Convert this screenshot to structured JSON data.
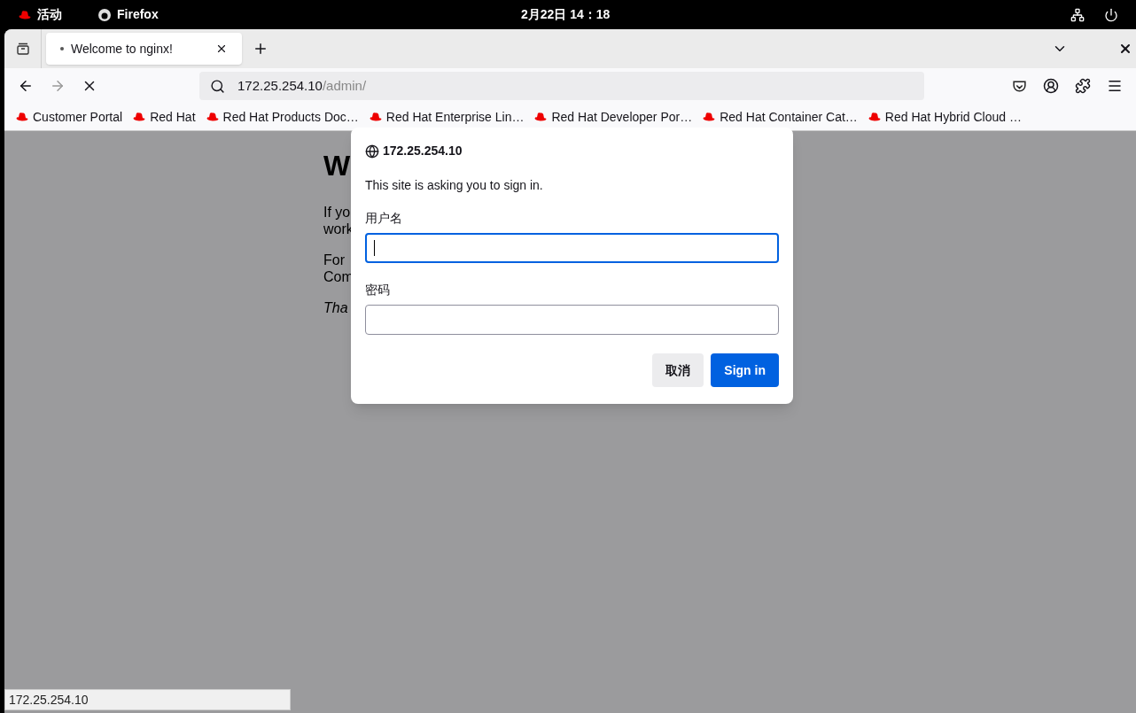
{
  "topbar": {
    "activities": "活动",
    "app": "Firefox",
    "clock": "2月22日 14：18"
  },
  "tabs": [
    {
      "title": "Welcome to nginx!",
      "selected": true,
      "loading": true
    }
  ],
  "urlbar": {
    "host": "172.25.254.10",
    "path": "/admin/"
  },
  "bookmarks": [
    "Customer Portal",
    "Red Hat",
    "Red Hat Products Doc…",
    "Red Hat Enterprise Lin…",
    "Red Hat Developer Por…",
    "Red Hat Container Cat…",
    "Red Hat Hybrid Cloud …"
  ],
  "page": {
    "heading": "W",
    "paragraphs": [
      {
        "lines": [
          "If yo",
          "work"
        ],
        "italic": false
      },
      {
        "lines": [
          "For",
          "Com"
        ],
        "italic": false
      },
      {
        "lines": [
          "Tha"
        ],
        "italic": true
      }
    ]
  },
  "dialog": {
    "site": "172.25.254.10",
    "message": "This site is asking you to sign in.",
    "fields": [
      {
        "label": "用户名",
        "focused": true
      },
      {
        "label": "密码",
        "focused": false
      }
    ],
    "buttons": [
      {
        "label": "取消",
        "kind": "secondary"
      },
      {
        "label": "Sign in",
        "kind": "primary"
      }
    ]
  },
  "status_bar": "172.25.254.10"
}
